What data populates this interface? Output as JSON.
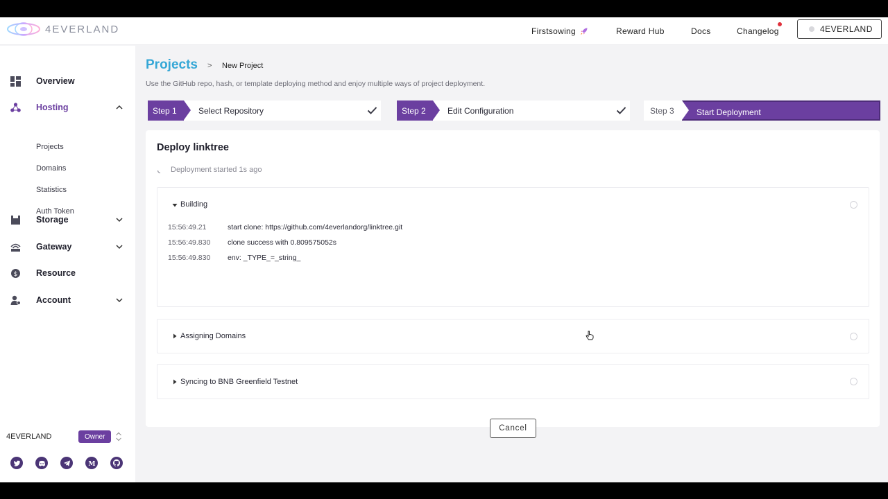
{
  "brand": {
    "name": "4EVERLAND"
  },
  "topnav": {
    "firstsowing": "Firstsowing",
    "reward_hub": "Reward Hub",
    "docs": "Docs",
    "changelog": "Changelog",
    "account": "4EVERLAND"
  },
  "sidebar": {
    "items": [
      {
        "label": "Overview",
        "icon": "dashboard-icon"
      },
      {
        "label": "Hosting",
        "icon": "hosting-icon",
        "expanded": true,
        "children": [
          "Projects",
          "Domains",
          "Statistics",
          "Auth Token"
        ]
      },
      {
        "label": "Storage",
        "icon": "storage-icon",
        "expanded": false
      },
      {
        "label": "Gateway",
        "icon": "gateway-icon",
        "expanded": false
      },
      {
        "label": "Resource",
        "icon": "resource-icon"
      },
      {
        "label": "Account",
        "icon": "account-icon",
        "expanded": false
      }
    ],
    "team": {
      "name": "4EVERLAND",
      "role": "Owner"
    },
    "social": [
      "twitter-icon",
      "discord-icon",
      "telegram-icon",
      "medium-icon",
      "github-icon"
    ]
  },
  "breadcrumb": {
    "root": "Projects",
    "separator": ">",
    "current": "New Project"
  },
  "subtitle": "Use the GitHub repo, hash, or template deploying method and enjoy multiple ways of project deployment.",
  "steps": [
    {
      "tag": "Step 1",
      "name": "Select Repository",
      "done": true
    },
    {
      "tag": "Step 2",
      "name": "Edit Configuration",
      "done": true
    },
    {
      "tag": "Step 3",
      "name": "Start Deployment",
      "current": true
    }
  ],
  "deploy": {
    "title": "Deploy linktree",
    "status": "Deployment started 1s ago",
    "stages": [
      {
        "title": "Building",
        "expanded": true,
        "logs": [
          {
            "time": "15:56:49.21",
            "message": "start clone: https://github.com/4everlandorg/linktree.git"
          },
          {
            "time": "15:56:49.830",
            "message": "clone success with 0.809575052s"
          },
          {
            "time": "15:56:49.830",
            "message": "env: _TYPE_=_string_"
          }
        ]
      },
      {
        "title": "Assigning Domains",
        "expanded": false
      },
      {
        "title": "Syncing to BNB Greenfield Testnet",
        "expanded": false
      }
    ],
    "cancel_label": "Cancel"
  },
  "colors": {
    "accent": "#6b3fa0",
    "title_blue": "#35a7d6",
    "notify_dot": "#e0323c"
  }
}
